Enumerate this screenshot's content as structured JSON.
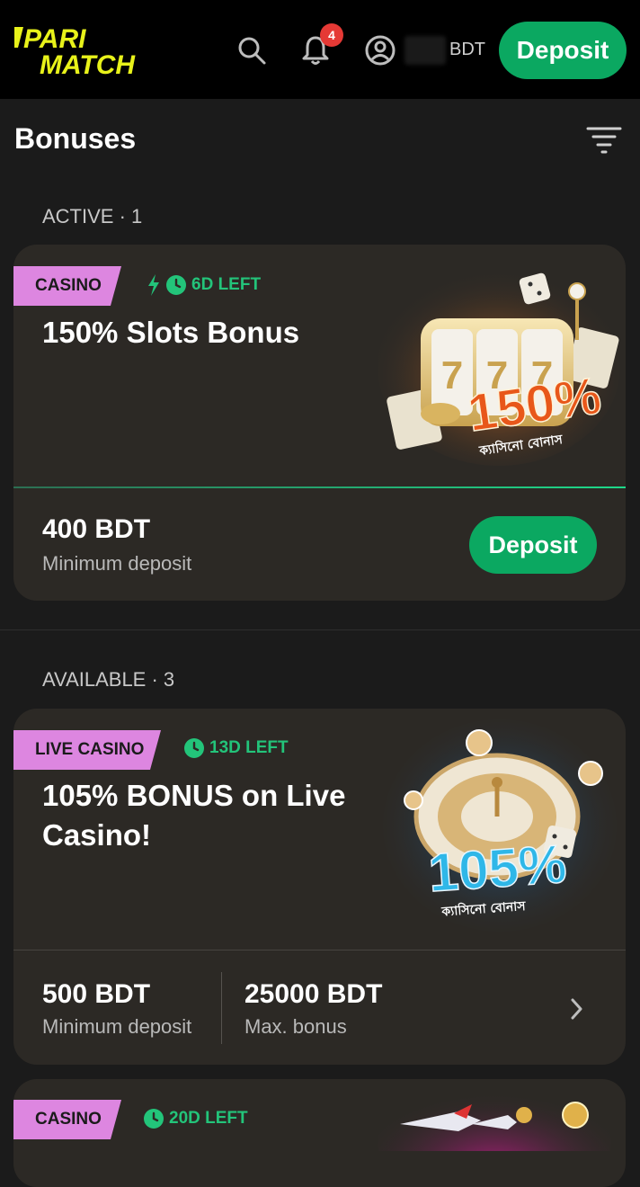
{
  "header": {
    "logo_text": "PARIMATCH",
    "notification_count": "4",
    "currency": "BDT",
    "deposit_label": "Deposit"
  },
  "page": {
    "title": "Bonuses"
  },
  "sections": {
    "active": {
      "label": "ACTIVE · 1"
    },
    "available": {
      "label": "AVAILABLE · 3"
    }
  },
  "cards": [
    {
      "tag": "CASINO",
      "timer": "6D LEFT",
      "title": "150% Slots Bonus",
      "promo_percent": "150%",
      "promo_caption": "ক্যাসিনো বোনাস",
      "amount": "400 BDT",
      "amount_label": "Minimum deposit",
      "button": "Deposit"
    },
    {
      "tag": "LIVE CASINO",
      "timer": "13D LEFT",
      "title_line1": "105% BONUS on Live",
      "title_line2": "Casino!",
      "promo_percent": "105%",
      "promo_caption": "ক্যাসিনো বোনাস",
      "amount": "500 BDT",
      "amount_label": "Minimum deposit",
      "max_amount": "25000 BDT",
      "max_label": "Max. bonus"
    },
    {
      "tag": "CASINO",
      "timer": "20D LEFT"
    }
  ],
  "colors": {
    "accent": "#0ba861",
    "tag": "#dd86e0",
    "timer": "#23c47a",
    "logo": "#e8f21a"
  }
}
